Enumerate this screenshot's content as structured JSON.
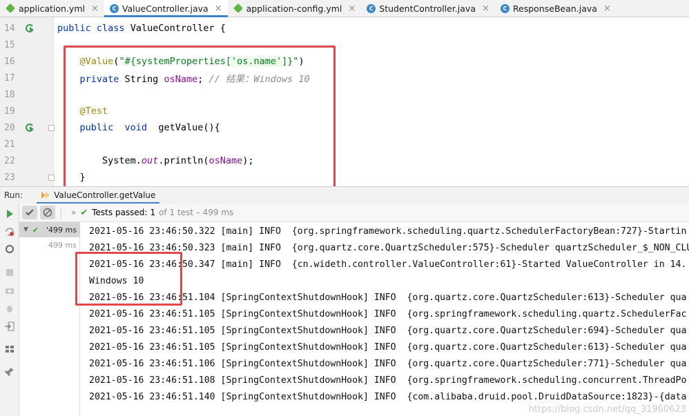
{
  "tabs": [
    {
      "label": "application.yml",
      "icon": "yml-file-icon",
      "active": false
    },
    {
      "label": "ValueController.java",
      "icon": "java-class-icon",
      "active": true
    },
    {
      "label": "application-config.yml",
      "icon": "yml-file-icon",
      "active": false
    },
    {
      "label": "StudentController.java",
      "icon": "java-class-icon",
      "active": false
    },
    {
      "label": "ResponseBean.java",
      "icon": "java-class-icon",
      "active": false
    }
  ],
  "editor": {
    "lines": [
      {
        "n": "14",
        "tokens": [
          [
            "kw",
            "public "
          ],
          [
            "kw",
            "class "
          ],
          [
            "p",
            "ValueController {"
          ]
        ]
      },
      {
        "n": "15",
        "tokens": []
      },
      {
        "n": "16",
        "tokens": [
          [
            "p",
            "    "
          ],
          [
            "ann",
            "@Value"
          ],
          [
            "p",
            "("
          ],
          [
            "str",
            "\"#{systemProperties["
          ],
          [
            "strq",
            "'os.name'"
          ],
          [
            "str",
            "]}\""
          ],
          [
            "p",
            ")"
          ]
        ]
      },
      {
        "n": "17",
        "tokens": [
          [
            "p",
            "    "
          ],
          [
            "kw",
            "private "
          ],
          [
            "p",
            "String "
          ],
          [
            "fld",
            "osName"
          ],
          [
            "p",
            "; "
          ],
          [
            "cmt",
            "// 结果：Windows 10"
          ]
        ]
      },
      {
        "n": "18",
        "tokens": []
      },
      {
        "n": "19",
        "tokens": [
          [
            "p",
            "    "
          ],
          [
            "ann",
            "@Test"
          ]
        ]
      },
      {
        "n": "20",
        "tokens": [
          [
            "p",
            "    "
          ],
          [
            "kw",
            "public  "
          ],
          [
            "kw",
            "void  "
          ],
          [
            "p",
            "getValue(){"
          ]
        ]
      },
      {
        "n": "21",
        "tokens": []
      },
      {
        "n": "22",
        "tokens": [
          [
            "p",
            "        System."
          ],
          [
            "st",
            "out"
          ],
          [
            "p",
            ".println("
          ],
          [
            "fld",
            "osName"
          ],
          [
            "p",
            ");"
          ]
        ]
      },
      {
        "n": "23",
        "tokens": [
          [
            "p",
            "    }"
          ]
        ]
      }
    ]
  },
  "run": {
    "label": "Run:",
    "config": "ValueController.getValue",
    "status_prefix": "Tests passed:",
    "status_count": "1",
    "status_suffix": "of 1 test – 499 ms",
    "tree": [
      {
        "label": "'499 ms",
        "selected": true
      },
      {
        "label": "499 ms",
        "selected": false
      }
    ]
  },
  "console": [
    "2021-05-16 23:46:50.322 [main] INFO  {org.springframework.scheduling.quartz.SchedulerFactoryBean:727}-Startin",
    "2021-05-16 23:46:50.323 [main] INFO  {org.quartz.core.QuartzScheduler:575}-Scheduler quartzScheduler_$_NON_CLU",
    "2021-05-16 23:46:50.347 [main] INFO  {cn.wideth.controller.ValueController:61}-Started ValueController in 14.",
    "Windows 10",
    "2021-05-16 23:46:51.104 [SpringContextShutdownHook] INFO  {org.quartz.core.QuartzScheduler:613}-Scheduler qua",
    "2021-05-16 23:46:51.105 [SpringContextShutdownHook] INFO  {org.springframework.scheduling.quartz.SchedulerFac",
    "2021-05-16 23:46:51.105 [SpringContextShutdownHook] INFO  {org.quartz.core.QuartzScheduler:694}-Scheduler qua",
    "2021-05-16 23:46:51.105 [SpringContextShutdownHook] INFO  {org.quartz.core.QuartzScheduler:613}-Scheduler qua",
    "2021-05-16 23:46:51.106 [SpringContextShutdownHook] INFO  {org.quartz.core.QuartzScheduler:771}-Scheduler qua",
    "2021-05-16 23:46:51.108 [SpringContextShutdownHook] INFO  {org.springframework.scheduling.concurrent.ThreadPo",
    "2021-05-16 23:46:51.140 [SpringContextShutdownHook] INFO  {com.alibaba.druid.pool.DruidDataSource:1823}-{data"
  ],
  "watermark": "https://blog.csdn.net/qq_31960623",
  "colors": {
    "keyword": "#0033b3",
    "annotation": "#9e880d",
    "string": "#067d17",
    "field": "#871094",
    "comment": "#8c8c8c",
    "highlight": "#e0474c",
    "tab_accent": "#4083c9",
    "pass_green": "#4a9c3c"
  }
}
